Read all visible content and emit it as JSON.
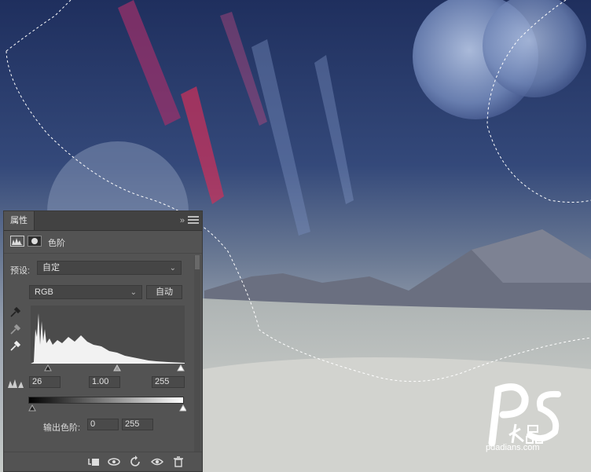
{
  "panel": {
    "tab_label": "属性",
    "collapse_glyph": "»",
    "adjustment_title": "色阶",
    "preset_label": "预设:",
    "preset_value": "自定",
    "channel_value": "RGB",
    "auto_label": "自动",
    "input_black": "26",
    "input_gamma": "1.00",
    "input_white": "255",
    "output_label": "输出色阶:",
    "output_black": "0",
    "output_white": "255"
  },
  "watermark": {
    "logo_text": "PS大品",
    "url": "pdadians.com"
  },
  "icons": [
    "levels-icon",
    "mask-icon",
    "eyedropper-black-icon",
    "eyedropper-gray-icon",
    "eyedropper-white-icon",
    "clip-to-layer-icon",
    "view-previous-icon",
    "reset-icon",
    "visibility-eye-icon",
    "trash-icon",
    "menu-icon"
  ],
  "colors": {
    "panel_bg": "#535353",
    "panel_dark": "#424242",
    "sky": "#2a3a6a",
    "desert": "#c9ccc8"
  }
}
